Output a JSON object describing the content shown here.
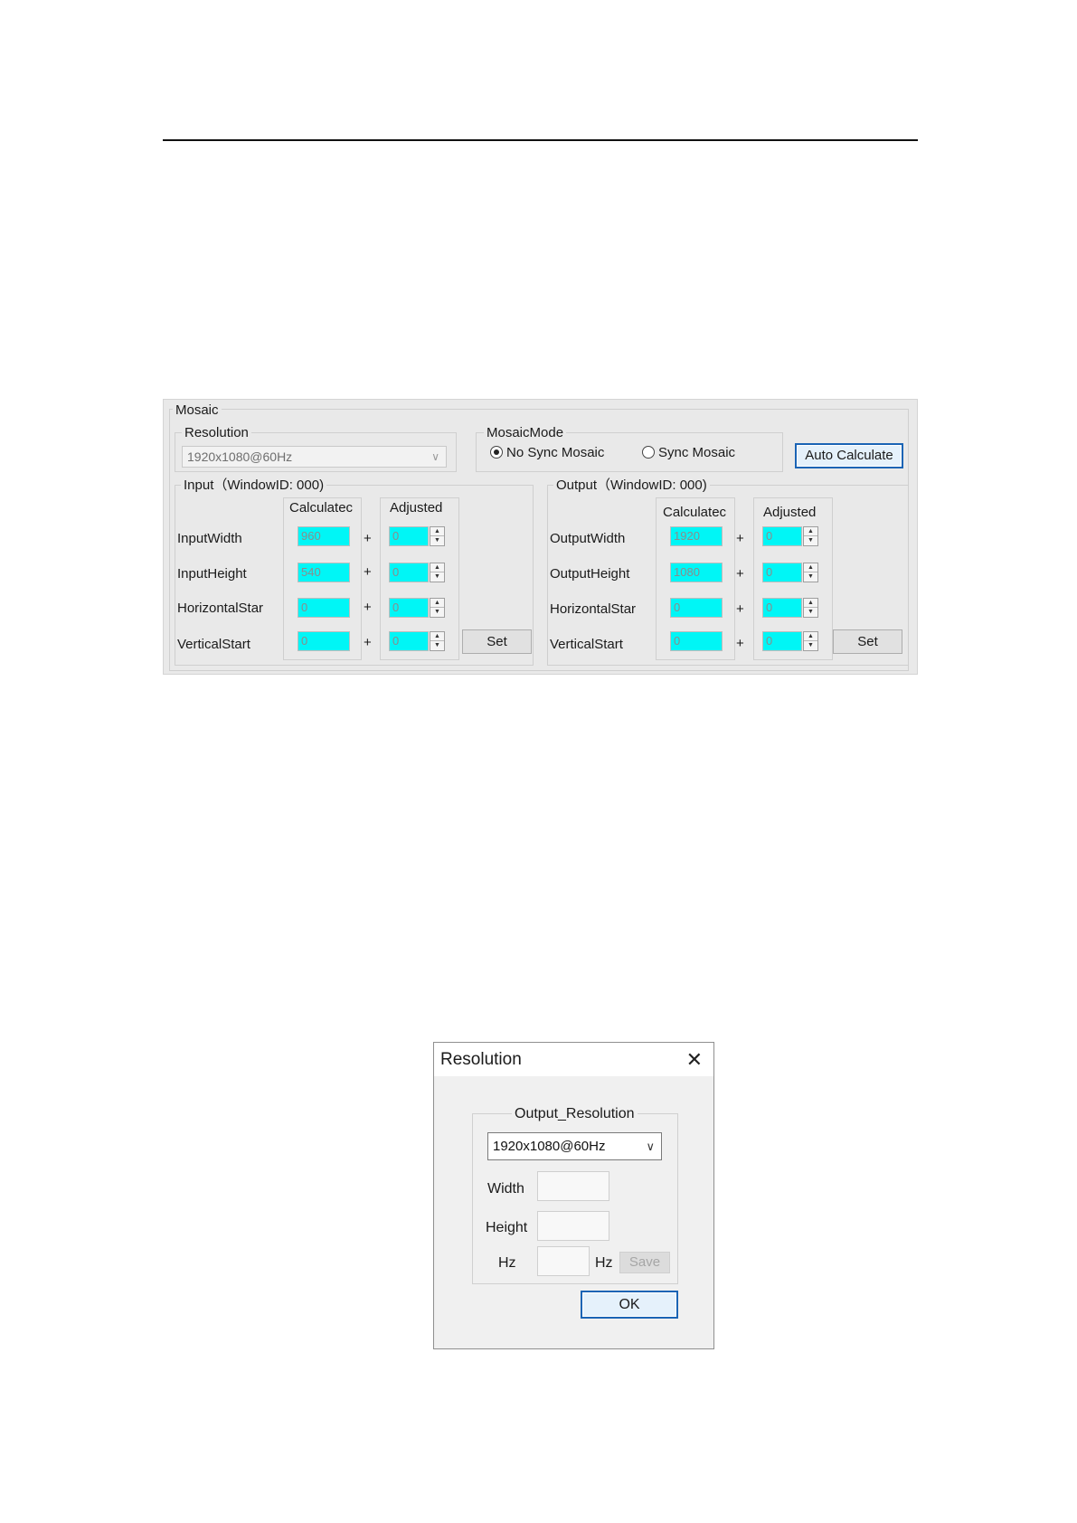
{
  "mosaic": {
    "title": "Mosaic",
    "resolution": {
      "legend": "Resolution",
      "value": "1920x1080@60Hz"
    },
    "mode": {
      "legend": "MosaicMode",
      "options": [
        "No Sync Mosaic",
        "Sync Mosaic"
      ],
      "selected": "No Sync Mosaic"
    },
    "auto_calculate": "Auto Calculate",
    "input": {
      "legend": "Input（WindowID: 000)",
      "col_calculated": "Calculatec",
      "col_adjusted": "Adjusted",
      "rows": [
        {
          "label": "InputWidth",
          "calculated": "960",
          "adjusted": "0"
        },
        {
          "label": "InputHeight",
          "calculated": "540",
          "adjusted": "0"
        },
        {
          "label": "HorizontalStar",
          "calculated": "0",
          "adjusted": "0"
        },
        {
          "label": "VerticalStart",
          "calculated": "0",
          "adjusted": "0"
        }
      ],
      "set": "Set"
    },
    "output": {
      "legend": "Output（WindowID: 000)",
      "col_calculated": "Calculatec",
      "col_adjusted": "Adjusted",
      "rows": [
        {
          "label": "OutputWidth",
          "calculated": "1920",
          "adjusted": "0"
        },
        {
          "label": "OutputHeight",
          "calculated": "1080",
          "adjusted": "0"
        },
        {
          "label": "HorizontalStar",
          "calculated": "0",
          "adjusted": "0"
        },
        {
          "label": "VerticalStart",
          "calculated": "0",
          "adjusted": "0"
        }
      ],
      "set": "Set"
    },
    "plus": "+"
  },
  "dialog": {
    "title": "Resolution",
    "group": "Output_Resolution",
    "selected": "1920x1080@60Hz",
    "width_label": "Width",
    "height_label": "Height",
    "hz_label": "Hz",
    "hz_unit": "Hz",
    "save": "Save",
    "ok": "OK"
  },
  "colors": {
    "field_cyan": "#00f6f6",
    "focus_blue": "#1a64b5"
  },
  "icons": [
    "chevron-down-icon",
    "close-icon",
    "spin-up-icon",
    "spin-down-icon"
  ]
}
